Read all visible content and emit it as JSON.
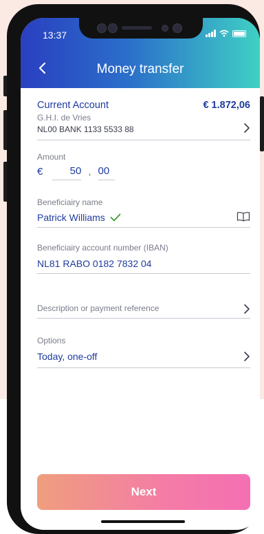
{
  "status": {
    "time": "13:37"
  },
  "header": {
    "title": "Money transfer",
    "back_icon": "chevron-left-icon"
  },
  "account": {
    "name": "Current Account",
    "balance": "€ 1.872,06",
    "holder": "G.H.I. de Vries",
    "number": "NL00 BANK 1133 5533 88"
  },
  "amount": {
    "label": "Amount",
    "currency": "€",
    "whole": "50",
    "separator": ",",
    "cents": "00"
  },
  "beneficiary": {
    "label": "Beneficiairy name",
    "value": "Patrick Williams",
    "address_book_icon": "book-icon"
  },
  "iban": {
    "label": "Beneficiairy account number (IBAN)",
    "value": "NL81 RABO 0182 7832 04"
  },
  "description": {
    "placeholder": "Description or payment reference"
  },
  "options": {
    "label": "Options",
    "value": "Today, one-off"
  },
  "next_button": {
    "label": "Next"
  },
  "colors": {
    "accent": "#1f3b9e",
    "header_start": "#2a3fc0",
    "header_end": "#3fd0c4",
    "button_start": "#ef9e7e",
    "button_end": "#f56fb3",
    "check": "#3f9c35"
  }
}
